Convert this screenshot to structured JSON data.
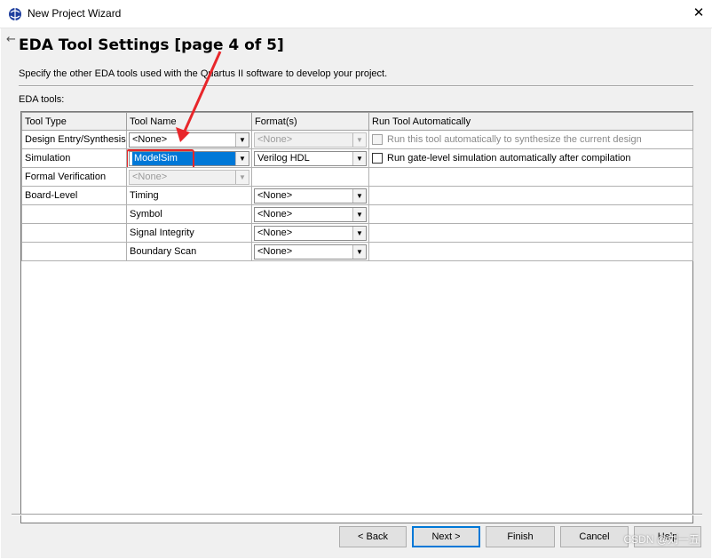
{
  "window": {
    "title": "New Project Wizard",
    "close_glyph": "✕"
  },
  "page": {
    "title": "EDA Tool Settings [page 4 of 5]",
    "description": "Specify the other EDA tools used with the Quartus II software to develop your project.",
    "group_label": "EDA tools:"
  },
  "table": {
    "headers": [
      "Tool Type",
      "Tool Name",
      "Format(s)",
      "Run Tool Automatically"
    ],
    "rows": [
      {
        "tool_type": "Design Entry/Synthesis",
        "tool_name": "<None>",
        "format": "<None>",
        "run_auto": "Run this tool automatically to synthesize the current design"
      },
      {
        "tool_type": "Simulation",
        "tool_name": "ModelSim",
        "format": "Verilog HDL",
        "run_auto": "Run gate-level simulation automatically after compilation"
      },
      {
        "tool_type": "Formal Verification",
        "tool_name": "<None>",
        "format": "",
        "run_auto": ""
      },
      {
        "tool_type": "Board-Level",
        "tool_name": "Timing",
        "format": "<None>",
        "run_auto": ""
      },
      {
        "tool_type": "",
        "tool_name": "Symbol",
        "format": "<None>",
        "run_auto": ""
      },
      {
        "tool_type": "",
        "tool_name": "Signal Integrity",
        "format": "<None>",
        "run_auto": ""
      },
      {
        "tool_type": "",
        "tool_name": "Boundary Scan",
        "format": "<None>",
        "run_auto": ""
      }
    ]
  },
  "buttons": {
    "back": "< Back",
    "next": "Next >",
    "finish": "Finish",
    "cancel": "Cancel",
    "help": "Help"
  },
  "watermark": "CSDN @刘一五",
  "colors": {
    "accent": "#0078d7",
    "annotation": "#e8262a"
  },
  "icons": {
    "app": "quartus-globe-icon",
    "back": "back-arrow-icon",
    "dropdown": "chevron-down-icon"
  }
}
